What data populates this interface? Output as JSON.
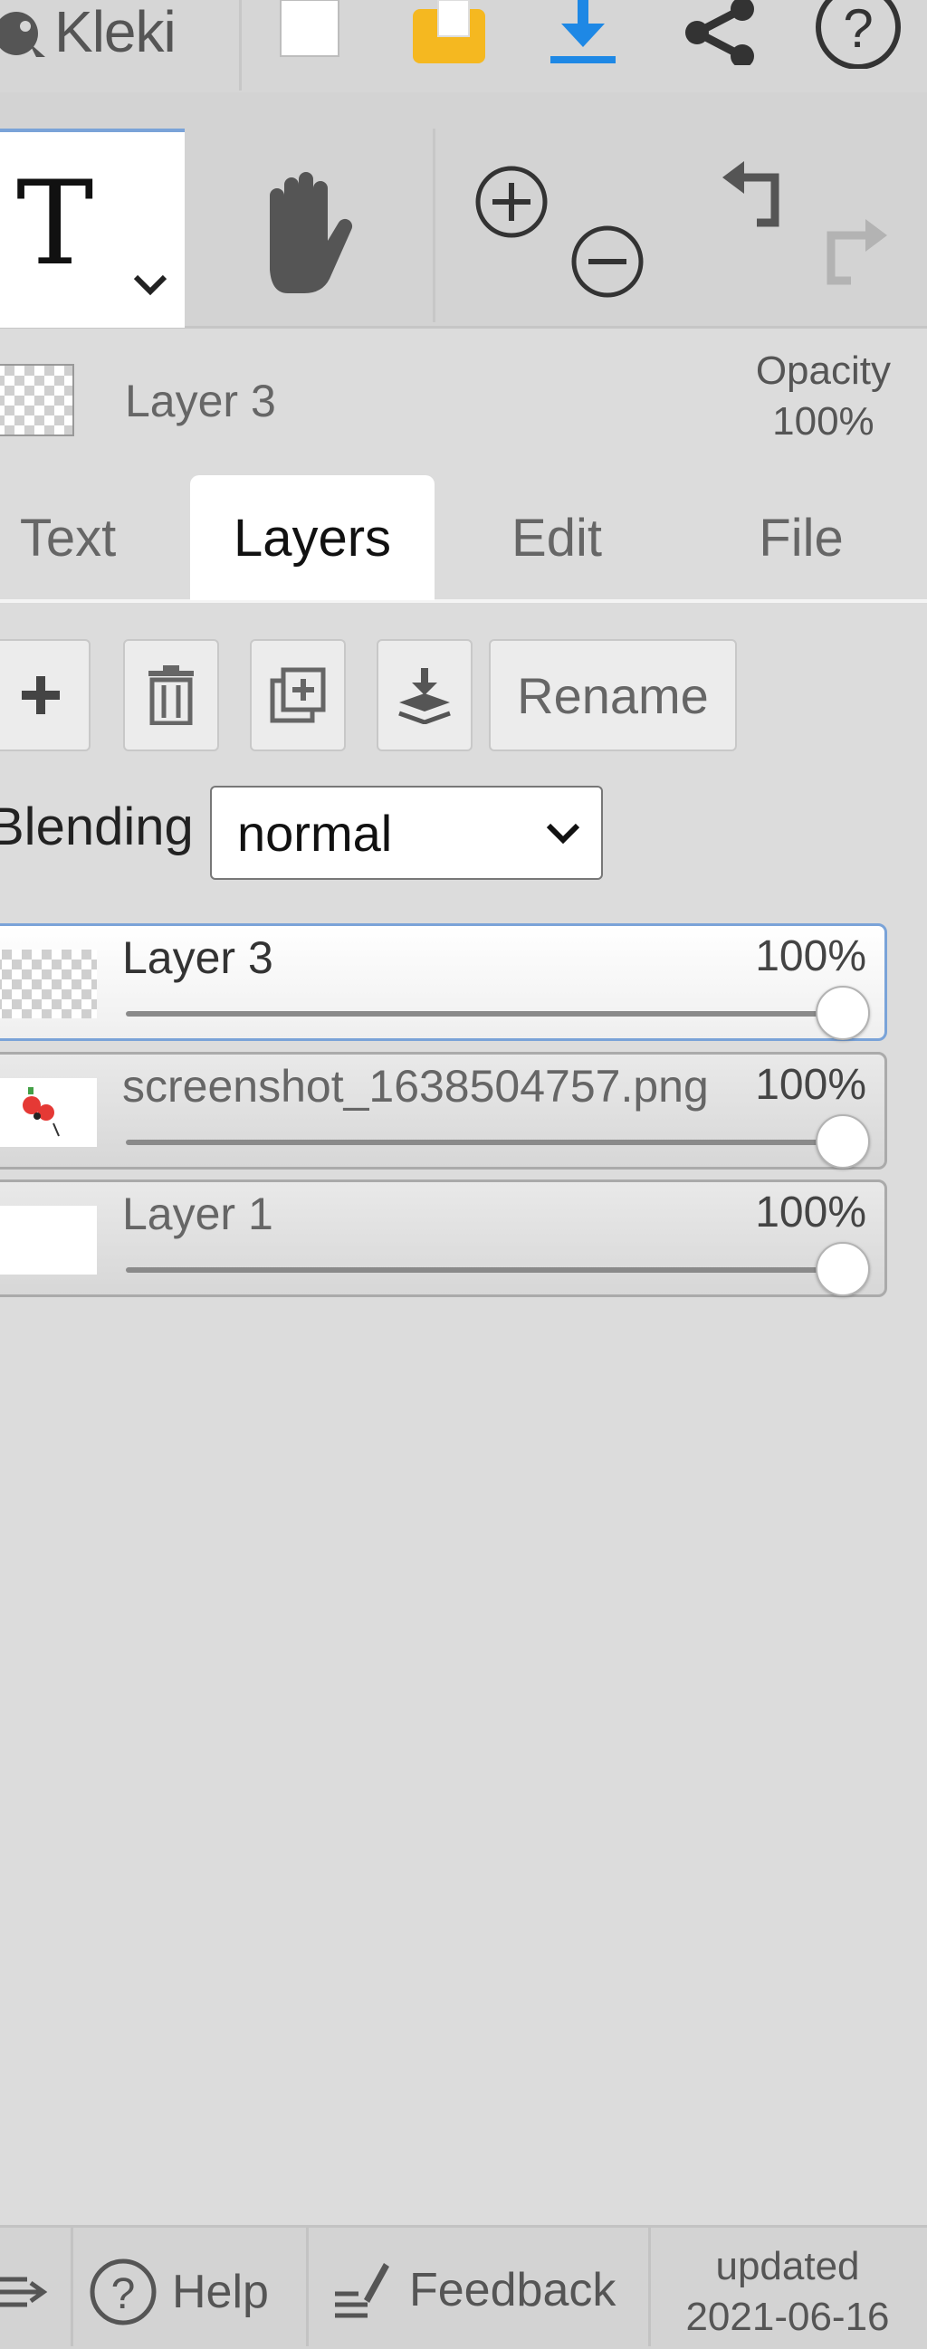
{
  "app": {
    "logo_text": "Kleki"
  },
  "status": {
    "layer_name": "Layer 3",
    "opacity_label": "Opacity",
    "opacity_value": "100%"
  },
  "tabs": [
    {
      "label": "Text",
      "active": false
    },
    {
      "label": "Layers",
      "active": true
    },
    {
      "label": "Edit",
      "active": false
    },
    {
      "label": "File",
      "active": false
    }
  ],
  "layer_buttons": {
    "rename_label": "Rename"
  },
  "blending": {
    "label": "Blending",
    "selected": "normal"
  },
  "layers": [
    {
      "name": "Layer 3",
      "opacity": "100%",
      "selected": true
    },
    {
      "name": "screenshot_1638504757.png",
      "opacity": "100%",
      "selected": false
    },
    {
      "name": "Layer 1",
      "opacity": "100%",
      "selected": false
    }
  ],
  "bottom": {
    "help_label": "Help",
    "feedback_label": "Feedback",
    "updated_label": "updated",
    "updated_date": "2021-06-16"
  },
  "colors": {
    "accent": "#1e88e5",
    "folder": "#f5b820",
    "selection_border": "#7aa3d8"
  }
}
